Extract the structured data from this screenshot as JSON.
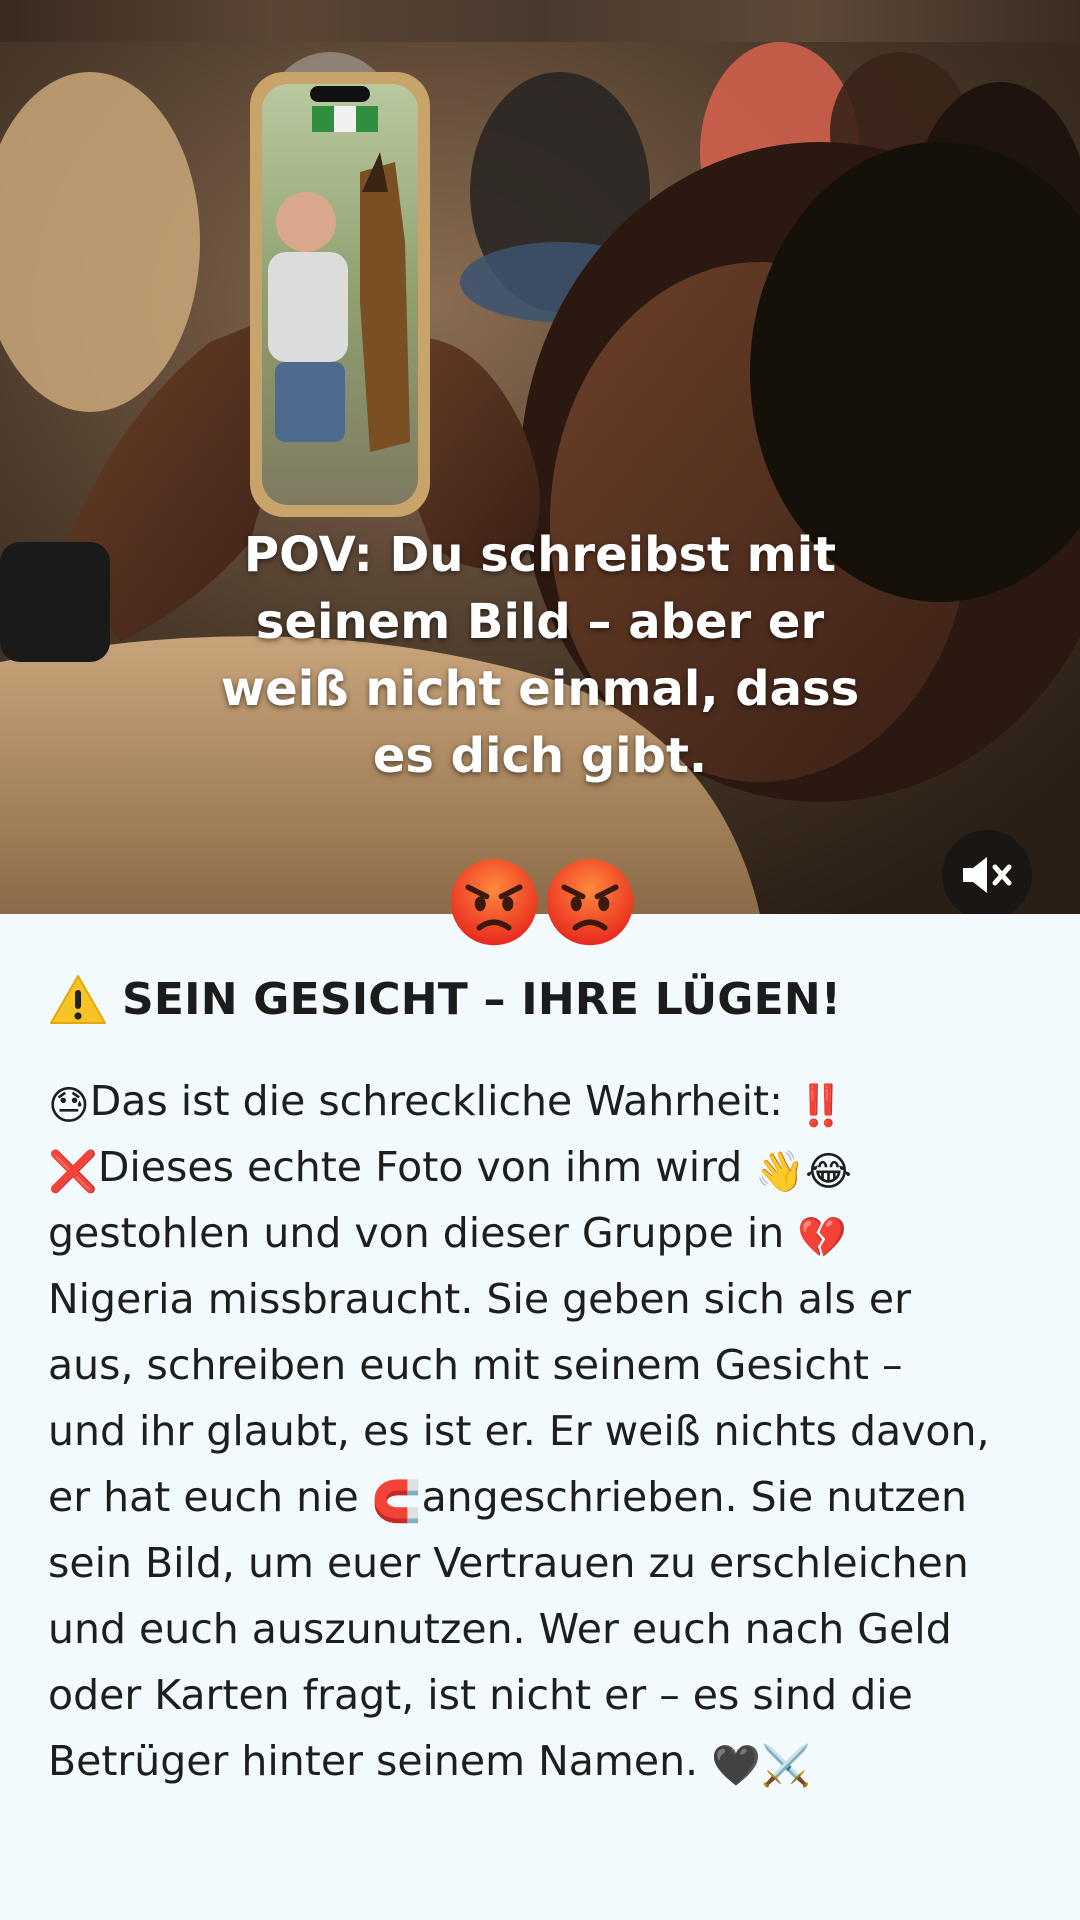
{
  "caption": {
    "lines": [
      "POV: Du schreibst mit",
      "seinem Bild – aber er",
      "weiß nicht einmal, dass",
      "es dich gibt."
    ]
  },
  "mute_icon": "speaker-muted-icon",
  "reactions": [
    "angry-face",
    "angry-face"
  ],
  "headline": {
    "icon": "warning-icon",
    "text": "SEIN GESICHT – IHRE LÜGEN!"
  },
  "body": {
    "lines": [
      {
        "pre": "😓",
        "text": "Das ist die schreckliche Wahrheit: ",
        "post": "‼️"
      },
      {
        "pre": "❌",
        "text": "Dieses echte Foto von ihm wird ",
        "post": "👋😂"
      },
      {
        "pre": "",
        "text": "gestohlen und von dieser Gruppe in ",
        "post": "💔"
      },
      {
        "pre": "",
        "text": "Nigeria missbraucht. Sie geben sich als er",
        "post": ""
      },
      {
        "pre": "",
        "text": "aus, schreiben euch mit seinem Gesicht –",
        "post": ""
      },
      {
        "pre": "",
        "text": "und ihr glaubt, es ist er. Er weiß nichts davon,",
        "post": ""
      },
      {
        "pre": "",
        "text": "er hat euch nie ",
        "mid": "🧲",
        "text2": "angeschrieben. Sie nutzen",
        "post": ""
      },
      {
        "pre": "",
        "text": "sein Bild, um euer Vertrauen zu erschleichen",
        "post": ""
      },
      {
        "pre": "",
        "text": "und euch auszunutzen. Wer euch nach Geld",
        "post": ""
      },
      {
        "pre": "",
        "text": "oder Karten fragt, ist nicht er – es sind die",
        "post": ""
      },
      {
        "pre": "",
        "text": "Betrüger hinter seinem Namen. ",
        "post": "🖤⚔️"
      }
    ]
  },
  "colors": {
    "page_background": "#f3fafd",
    "text": "#1c1c1c",
    "caption_text": "#ffffff"
  }
}
